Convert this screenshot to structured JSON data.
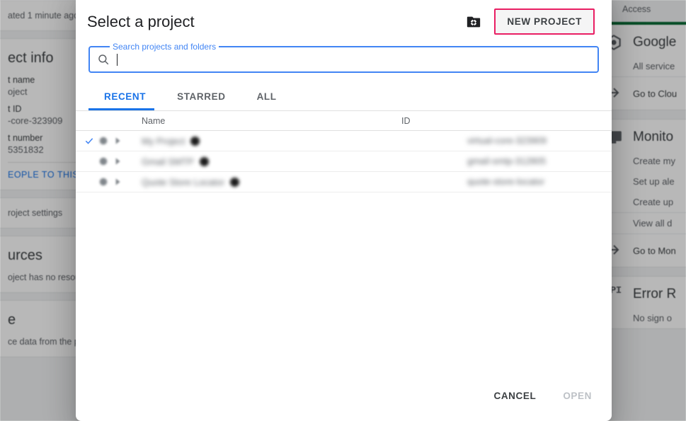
{
  "dialog": {
    "title": "Select a project",
    "manage_folders_icon": "folder-gear-icon",
    "new_project_label": "NEW PROJECT",
    "new_project_highlight_color": "#e91e63",
    "search": {
      "legend": "Search projects and folders",
      "value": "",
      "placeholder": "",
      "icon": "search-icon"
    },
    "tabs": [
      {
        "label": "RECENT",
        "active": true
      },
      {
        "label": "STARRED",
        "active": false
      },
      {
        "label": "ALL",
        "active": false
      }
    ],
    "table": {
      "headers": {
        "name": "Name",
        "id": "ID"
      },
      "rows": [
        {
          "selected": true,
          "check_icon": "check-icon",
          "star_icon": "star-icon",
          "expand_icon": "caret-right-icon",
          "name": "My Project",
          "id": "virtual-core-323909"
        },
        {
          "selected": false,
          "check_icon": "check-icon",
          "star_icon": "star-icon",
          "expand_icon": "caret-right-icon",
          "name": "Gmail SMTP",
          "id": "gmail-smtp-312805"
        },
        {
          "selected": false,
          "check_icon": "check-icon",
          "star_icon": "star-icon",
          "expand_icon": "caret-right-icon",
          "name": "Quote Store Locator",
          "id": "quote-store-locator"
        }
      ]
    },
    "footer": {
      "cancel_label": "CANCEL",
      "open_label": "OPEN",
      "open_disabled": true
    }
  },
  "background": {
    "left": {
      "updated_note": "ated 1 minute ago",
      "project_info_title": "ect info",
      "project_name_label": "t name",
      "project_name_value": "oject",
      "project_id_label": "t ID",
      "project_id_value": "-core-323909",
      "project_number_label": "t number",
      "project_number_value": "5351832",
      "add_people_link": "EOPLE TO THIS PR",
      "project_settings_link": "roject settings",
      "resources_title": "urces",
      "resources_body": "oject has no resou",
      "trace_title": "e",
      "trace_body": "ce data from the pa"
    },
    "right": {
      "access_label": "Access",
      "google_card": {
        "accent_color": "#0b6b35",
        "icon": "google-cloud-hex-icon",
        "title": "Google",
        "row1": "All service",
        "footer_icon": "arrow-right-icon",
        "footer": "Go to Clou"
      },
      "monitoring_card": {
        "icon": "monitoring-chart-icon",
        "title": "Monito",
        "row1": "Create my",
        "row2": "Set up ale",
        "row3": "Create up",
        "row4": "View all d",
        "footer_icon": "arrow-right-icon",
        "footer": "Go to Mon"
      },
      "error_card": {
        "badge": "API",
        "title": "Error R",
        "row1": "No sign o"
      }
    }
  }
}
